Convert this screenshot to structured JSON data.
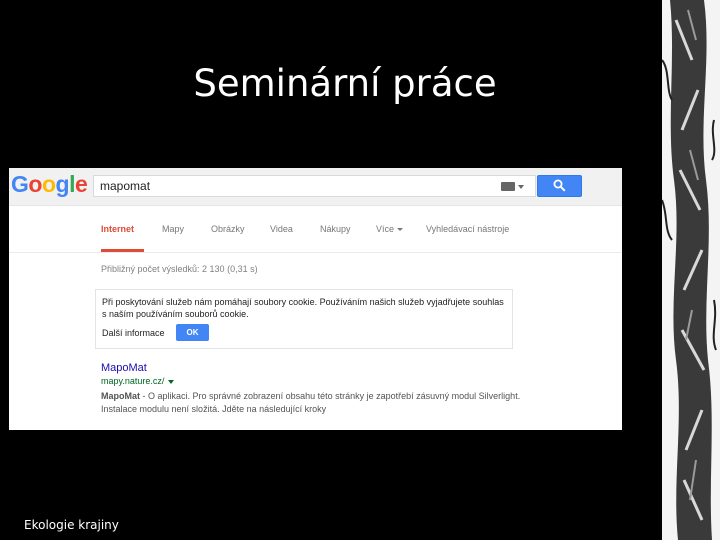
{
  "slide": {
    "title": "Seminární práce",
    "footer": "Ekologie krajiny"
  },
  "google": {
    "logo_letters": [
      {
        "ch": "G",
        "color": "#4285f4"
      },
      {
        "ch": "o",
        "color": "#ea4335"
      },
      {
        "ch": "o",
        "color": "#fbbc05"
      },
      {
        "ch": "g",
        "color": "#4285f4"
      },
      {
        "ch": "l",
        "color": "#34a853"
      },
      {
        "ch": "e",
        "color": "#ea4335"
      }
    ],
    "search": {
      "query": "mapomat",
      "button_icon": "search-icon",
      "keyboard_icon": "keyboard-icon"
    },
    "tabs": [
      {
        "label": "Internet",
        "active": true
      },
      {
        "label": "Mapy"
      },
      {
        "label": "Obrázky"
      },
      {
        "label": "Videa"
      },
      {
        "label": "Nákupy"
      },
      {
        "label": "Více"
      },
      {
        "label": "Vyhledávací nástroje"
      }
    ],
    "stats": "Přibližný počet výsledků: 2 130 (0,31 s)",
    "cookie_notice": {
      "text": "Při poskytování služeb nám pomáhají soubory cookie. Používáním našich služeb vyjadřujete souhlas s naším používáním souborů cookie.",
      "more_label": "Další informace",
      "ok_label": "OK"
    },
    "result": {
      "title": "MapoMat",
      "url": "mapy.nature.cz/",
      "snippet_bold": "MapoMat",
      "snippet": " - O aplikaci. Pro správné zobrazení obsahu této stránky je zapotřebí zásuvný modul Silverlight. Instalace modulu není složitá. Jděte na následující kroky"
    }
  },
  "colors": {
    "accent_red": "#dd4b39",
    "link_blue": "#1a0dab",
    "url_green": "#006621",
    "button_blue": "#4285f4"
  }
}
